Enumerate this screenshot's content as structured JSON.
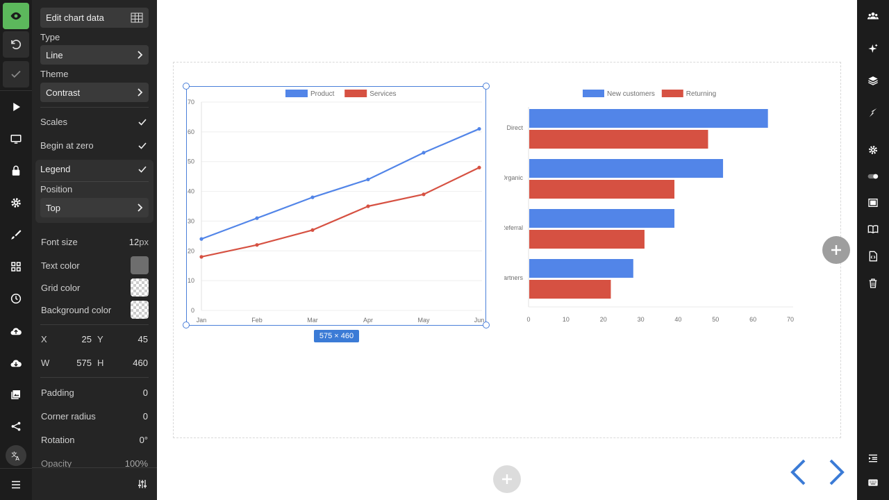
{
  "panel": {
    "edit_chart_data": "Edit chart data",
    "type_label": "Type",
    "type_value": "Line",
    "theme_label": "Theme",
    "theme_value": "Contrast",
    "scales_label": "Scales",
    "begin_zero_label": "Begin at zero",
    "legend_label": "Legend",
    "position_label": "Position",
    "position_value": "Top",
    "font_size_label": "Font size",
    "font_size_value": "12",
    "font_size_unit": "px",
    "text_color_label": "Text color",
    "text_color_value": "#6e6e6e",
    "grid_color_label": "Grid color",
    "bg_color_label": "Background color",
    "x_label": "X",
    "x_value": "25",
    "y_label": "Y",
    "y_value": "45",
    "w_label": "W",
    "w_value": "575",
    "h_label": "H",
    "h_value": "460",
    "padding_label": "Padding",
    "padding_value": "0",
    "corner_radius_label": "Corner radius",
    "corner_radius_value": "0",
    "rotation_label": "Rotation",
    "rotation_value": "0°",
    "opacity_label": "Opacity",
    "opacity_value": "100%"
  },
  "selection": {
    "size_label": "575 × 460"
  },
  "colors": {
    "accent_green": "#5cb85c",
    "selection_blue": "#4a7fd9",
    "series_blue": "#5285e8",
    "series_red": "#d65142"
  },
  "icons": {
    "left_rail": [
      "eye-icon",
      "undo-icon",
      "check-icon",
      "play-icon",
      "monitor-icon",
      "lock-icon",
      "gear-icon",
      "brush-icon",
      "grid-icon",
      "clock-icon",
      "cloud-upload-icon",
      "cloud-download-icon",
      "image-icon",
      "share-icon",
      "translate-icon",
      "menu-icon"
    ],
    "right_rail": [
      "users-icon",
      "sparkle-icon",
      "layers-icon",
      "bolt-icon",
      "gear-icon",
      "toggle-icon",
      "screen-icon",
      "book-icon",
      "code-file-icon",
      "trash-icon",
      "indent-icon",
      "keyboard-icon"
    ]
  },
  "chart_data": [
    {
      "type": "line",
      "categories": [
        "Jan",
        "Feb",
        "Mar",
        "Apr",
        "May",
        "Jun"
      ],
      "series": [
        {
          "name": "Product",
          "values": [
            24,
            31,
            38,
            44,
            53,
            61
          ]
        },
        {
          "name": "Services",
          "values": [
            18,
            22,
            27,
            35,
            39,
            48
          ]
        }
      ],
      "ylim": [
        0,
        70
      ],
      "yticks": [
        0,
        10,
        20,
        30,
        40,
        50,
        60,
        70
      ],
      "grid": true,
      "legend": "top"
    },
    {
      "type": "bar",
      "orientation": "horizontal",
      "categories": [
        "Direct",
        "Organic",
        "Referral",
        "Partners"
      ],
      "series": [
        {
          "name": "New customers",
          "values": [
            64,
            52,
            39,
            28
          ]
        },
        {
          "name": "Returning",
          "values": [
            48,
            39,
            31,
            22
          ]
        }
      ],
      "xlim": [
        0,
        70
      ],
      "xticks": [
        0,
        10,
        20,
        30,
        40,
        50,
        60,
        70
      ],
      "grid": false,
      "legend": "top"
    }
  ]
}
